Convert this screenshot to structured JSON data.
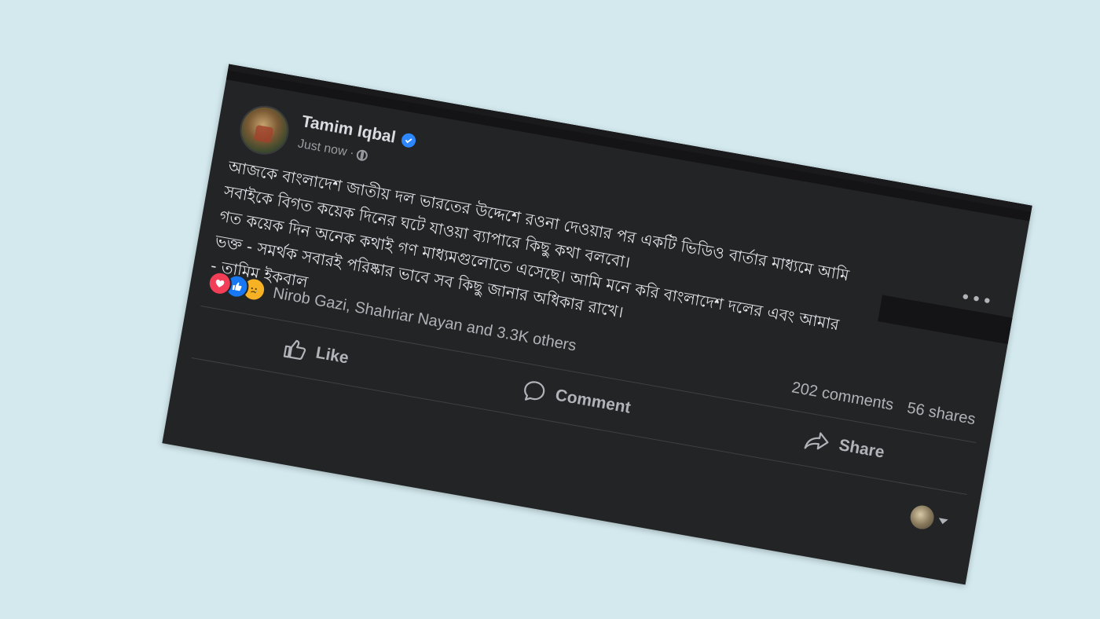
{
  "post": {
    "author": "Tamim Iqbal",
    "timestamp": "Just now",
    "separator": "·",
    "text_lines": [
      "আজকে বাংলাদেশ জাতীয় দল ভারতের উদ্দেশে রওনা দেওয়ার পর একটি ভিডিও বার্তার মাধ্যমে আমি",
      "সবাইকে বিগত কয়েক দিনের ঘটে যাওয়া ব্যাপারে কিছু কথা বলবো।",
      "গত কয়েক দিন অনেক কথাই গণ মাধ্যমগুলোতে এসেছে।  আমি মনে করি বাংলাদেশ দলের এবং আমার",
      "ভক্ত - সমর্থক সবারই পরিষ্কার ভাবে সব কিছু জানার অধিকার রাখে।",
      "- তামিম ইকবাল"
    ],
    "reactors": "Nirob Gazi, Shahriar Nayan and 3.3K others",
    "comments_count": "202 comments",
    "shares_count": "56 shares",
    "more_label": "•••"
  },
  "actions": {
    "like": "Like",
    "comment": "Comment",
    "share": "Share"
  },
  "icons": [
    "globe-icon",
    "verified-badge-icon",
    "more-options-icon",
    "love-reaction-icon",
    "like-reaction-icon",
    "sad-reaction-icon",
    "like-icon",
    "comment-icon",
    "share-icon",
    "chevron-down-icon"
  ],
  "colors": {
    "background": "#d3e9ee",
    "card": "#232426",
    "text": "#e4e6eb",
    "secondary_text": "#b0b3b8",
    "verified": "#2d88ff",
    "like_blue": "#1877f2",
    "love_red": "#f33e58",
    "sad_yellow": "#f7b125"
  }
}
